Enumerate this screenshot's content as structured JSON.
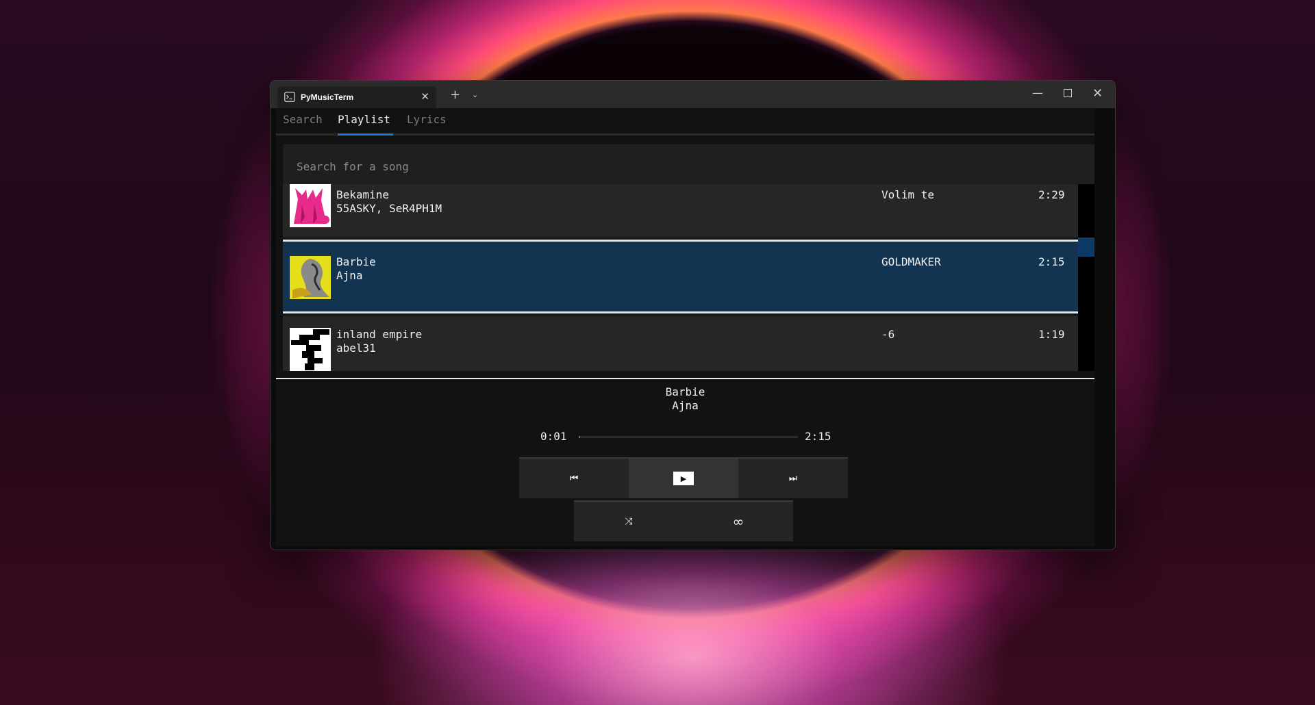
{
  "window": {
    "tab_title": "PyMusicTerm",
    "tab_icon": "terminal-icon",
    "new_tab_label": "+",
    "tab_menu_label": "⌄",
    "minimize_label": "—",
    "close_label": "✕"
  },
  "nav": {
    "tabs": [
      {
        "label": "Search"
      },
      {
        "label": "Playlist",
        "active": true
      },
      {
        "label": "Lyrics"
      }
    ]
  },
  "search": {
    "placeholder": "Search for a song",
    "value": ""
  },
  "songs": [
    {
      "title": "Bekamine",
      "artist": "55ASKY, SeR4PH1M",
      "album": "Volim te",
      "duration": "2:29",
      "cover": "pink-figures-cover",
      "selected": false
    },
    {
      "title": "Barbie",
      "artist": "Ajna",
      "album": "GOLDMAKER",
      "duration": "2:15",
      "cover": "yellow-sculpture-cover",
      "selected": true
    },
    {
      "title": "inland empire",
      "artist": "abel31",
      "album": "-6",
      "duration": "1:19",
      "cover": "black-white-glitch-cover",
      "selected": false
    }
  ],
  "now_playing": {
    "title": "Barbie",
    "artist": "Ajna",
    "current_time": "0:01",
    "total_time": "2:15",
    "progress": 0.0074
  },
  "controls": {
    "previous_icon": "skip-previous-icon",
    "play_icon": "play-icon",
    "next_icon": "skip-next-icon",
    "shuffle_icon": "shuffle-icon",
    "loop_icon": "infinity-icon",
    "previous_glyph": "⏮",
    "play_glyph": "▶",
    "next_glyph": "⏭",
    "shuffle_glyph": "⤨",
    "loop_glyph": "∞"
  },
  "colors": {
    "accent": "#1a7ad1",
    "selected_row": "#133451",
    "row_bg": "#262626",
    "scroll_thumb": "#0d3a66"
  }
}
